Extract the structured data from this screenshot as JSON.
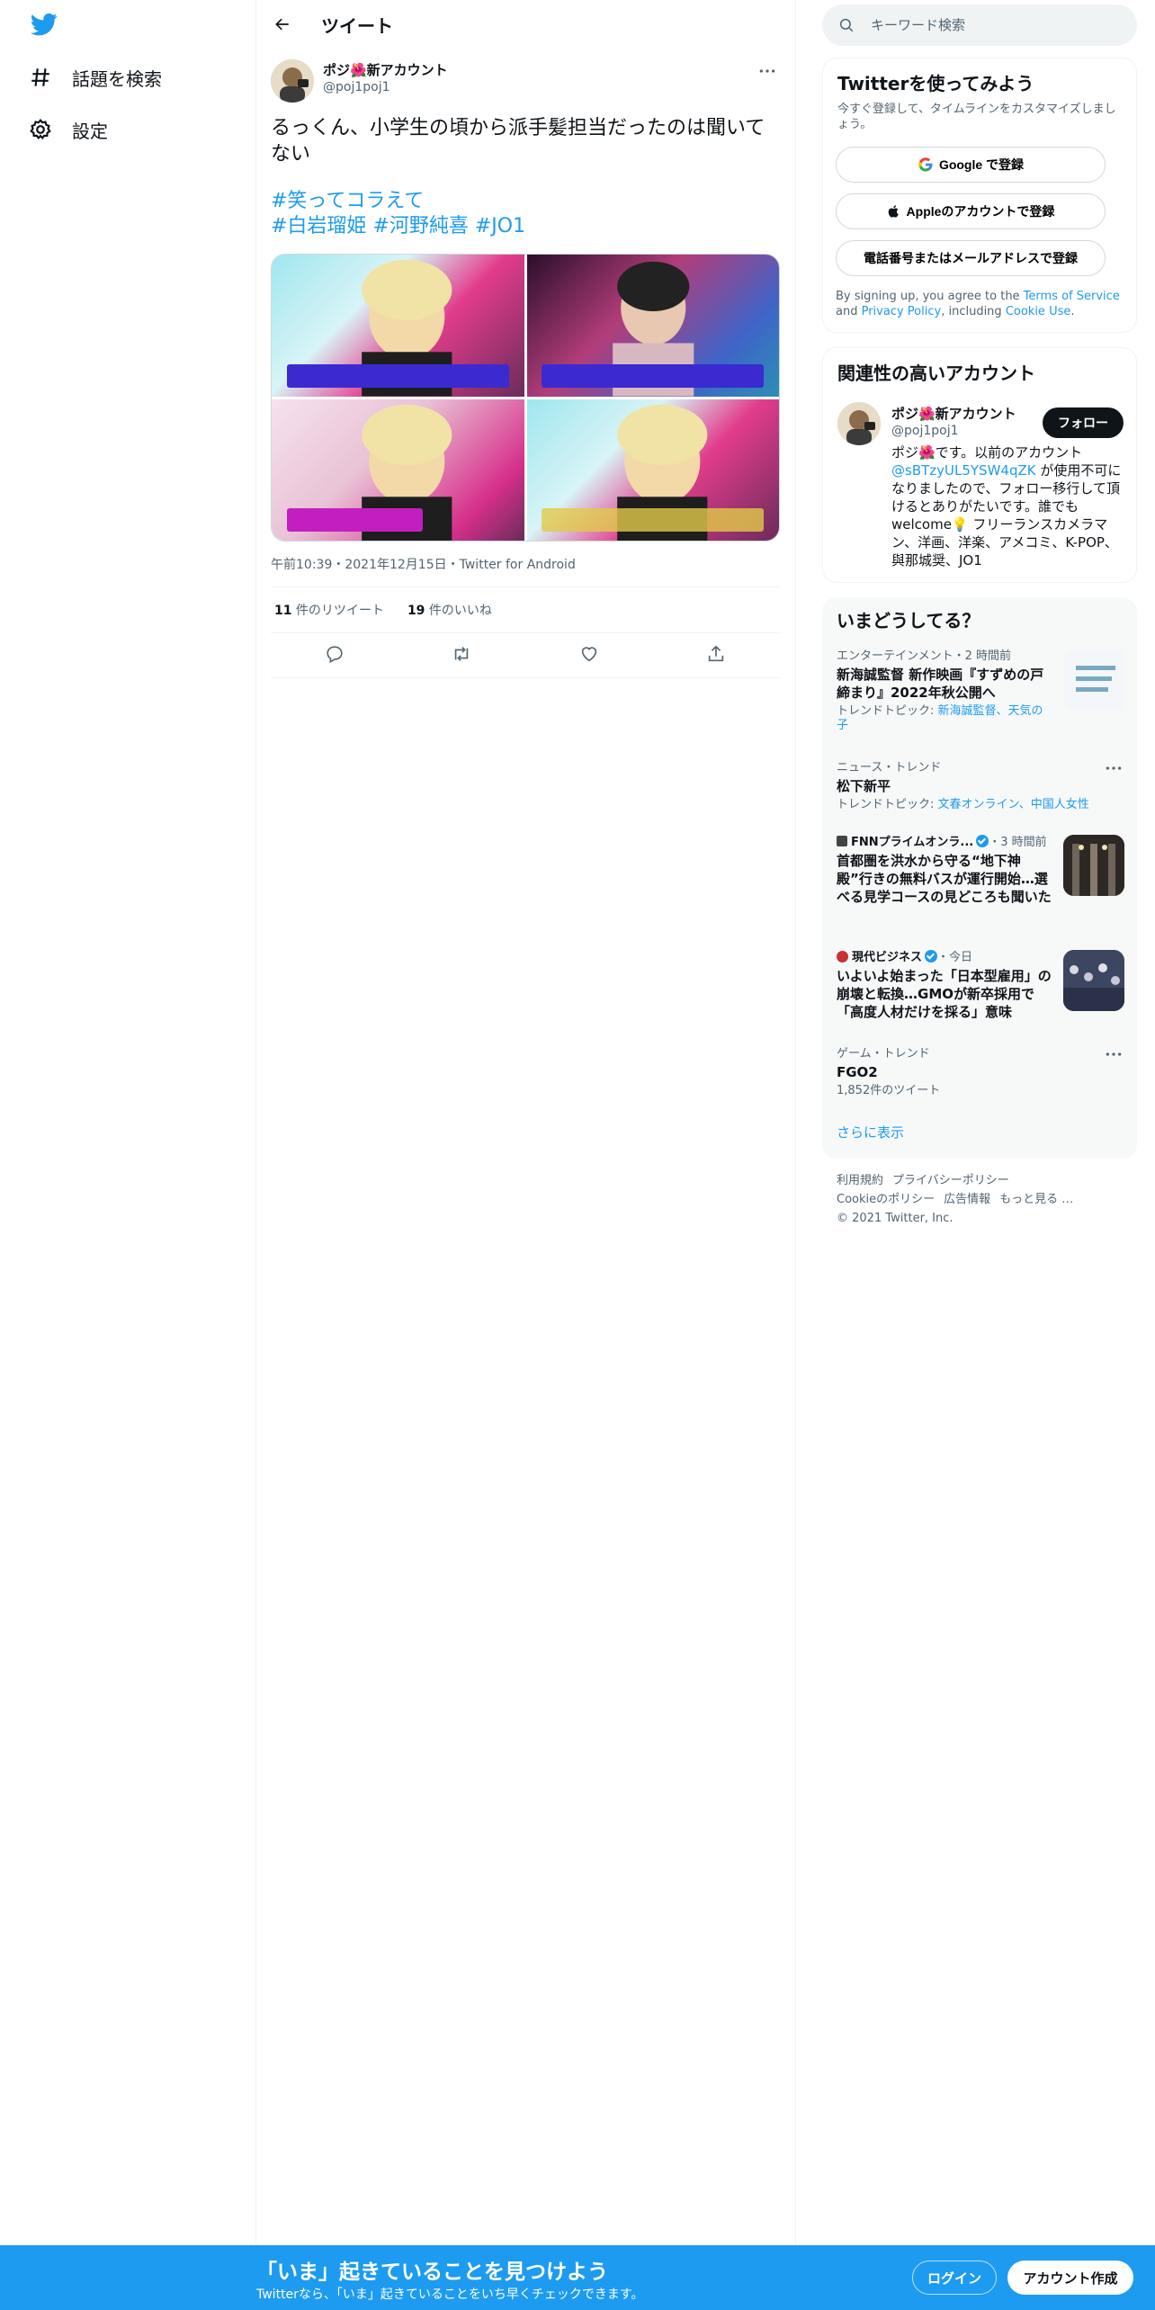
{
  "nav": {
    "logo_icon": "twitter-bird-icon",
    "items": [
      {
        "label": "話題を検索",
        "icon": "hashtag-icon"
      },
      {
        "label": "設定",
        "icon": "gear-icon"
      }
    ]
  },
  "header": {
    "title": "ツイート",
    "back_icon": "arrow-left-icon"
  },
  "tweet": {
    "author_name": "ポジ🌺新アカウント",
    "author_handle": "@poj1poj1",
    "text": "るっくん、小学生の頃から派手髪担当だったのは聞いてない",
    "hashtags_line1": "#笑ってコラえて",
    "hashtags_line2": [
      "#白岩瑠姫",
      "#河野純喜",
      "#JO1"
    ],
    "time": "午前10:39",
    "date": "2021年12月15日",
    "source": "Twitter for Android",
    "retweets_count": "11",
    "retweets_label": " 件のリツイート",
    "likes_count": "19",
    "likes_label": " 件のいいね"
  },
  "search": {
    "placeholder": "キーワード検索"
  },
  "signup_card": {
    "title": "Twitterを使ってみよう",
    "subtitle": "今すぐ登録して、タイムラインをカスタマイズしましょう。",
    "google_label": "Google で登録",
    "apple_label": "Appleのアカウントで登録",
    "phone_label": "電話番号またはメールアドレスで登録",
    "terms_prefix": "By signing up, you agree to the ",
    "terms_link": "Terms of Service",
    "terms_and": " and ",
    "privacy_link": "Privacy Policy",
    "terms_including": ", including ",
    "cookie_link": "Cookie Use",
    "terms_end": "."
  },
  "relevant": {
    "title": "関連性の高いアカウント",
    "name": "ポジ🌺新アカウント",
    "handle": "@poj1poj1",
    "follow_label": "フォロー",
    "bio_prefix": "ポジ🌺です。以前のアカウント",
    "bio_link": "@sBTzyUL5YSW4qZK",
    "bio_suffix": " が使用不可になりましたので、フォロー移行して頂けるとありがたいです。誰でもwelcome💡 フリーランスカメラマン、洋画、洋楽、アメコミ、K-POP、與那城奨、JO1"
  },
  "trends": {
    "title": "いまどうしてる？",
    "items": [
      {
        "context": "エンターテインメント・2 時間前",
        "name": "新海誠監督 新作映画『すずめの戸締まり』2022年秋公開へ",
        "sub_prefix": "トレンドトピック: ",
        "sub_links": "新海誠監督、天気の子"
      },
      {
        "context": "ニュース・トレンド",
        "name": "松下新平",
        "sub_prefix": "トレンドトピック: ",
        "sub_links": "文春オンライン、中国人女性"
      },
      {
        "source": "FNNプライムオンラ...",
        "time": "・3 時間前",
        "name": "首都圏を洪水から守る“地下神殿”行きの無料バスが運行開始…選べる見学コースの見どころも聞いた"
      },
      {
        "source": "現代ビジネス",
        "time": "・今日",
        "name": "いよいよ始まった「日本型雇用」の崩壊と転換…GMOが新卒採用で「高度人材だけを採る」意味"
      },
      {
        "context": "ゲーム・トレンド",
        "name": "FGO2",
        "sub": "1,852件のツイート"
      }
    ],
    "show_more": "さらに表示"
  },
  "footer": {
    "links": [
      "利用規約",
      "プライバシーポリシー",
      "Cookieのポリシー",
      "広告情報",
      "もっと見る …"
    ],
    "copyright": "© 2021 Twitter, Inc."
  },
  "bottom_bar": {
    "title": "「いま」起きていることを見つけよう",
    "subtitle": "Twitterなら、「いま」起きていることをいち早くチェックできます。",
    "login_label": "ログイン",
    "signup_label": "アカウント作成"
  },
  "colors": {
    "accent": "#1d9bf0",
    "text": "#0f1419",
    "muted": "#536471"
  }
}
